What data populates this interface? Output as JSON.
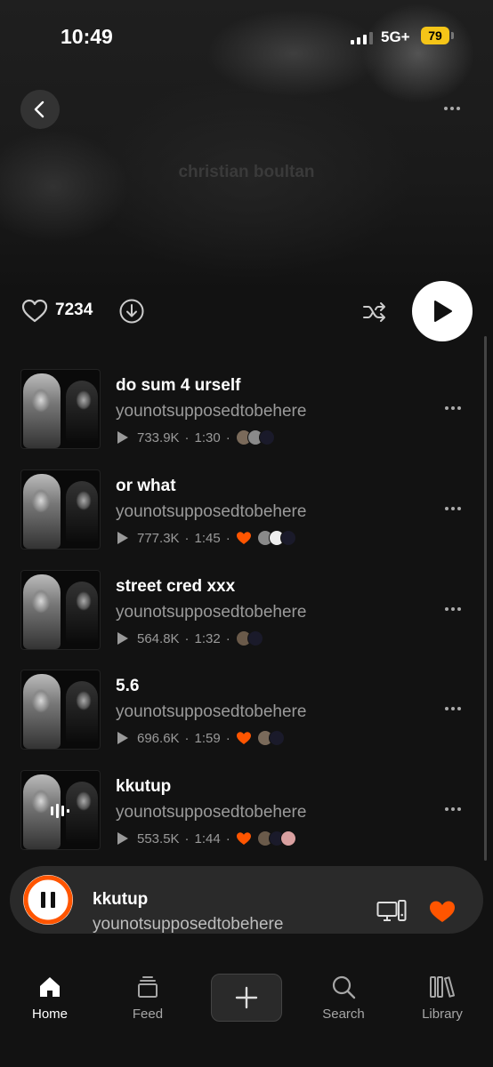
{
  "status_bar": {
    "time": "10:49",
    "network": "5G+",
    "battery": "79"
  },
  "header": {
    "playlist_title": "christian boultan"
  },
  "actions": {
    "like_count": "7234"
  },
  "tracks": [
    {
      "title": "do sum 4 urself",
      "artist": "younotsupposedtobehere",
      "plays": "733.9K",
      "duration": "1:30",
      "liked": false,
      "now_playing": false
    },
    {
      "title": "or what",
      "artist": "younotsupposedtobehere",
      "plays": "777.3K",
      "duration": "1:45",
      "liked": true,
      "now_playing": false
    },
    {
      "title": "street cred xxx",
      "artist": "younotsupposedtobehere",
      "plays": "564.8K",
      "duration": "1:32",
      "liked": false,
      "now_playing": false
    },
    {
      "title": "5.6",
      "artist": "younotsupposedtobehere",
      "plays": "696.6K",
      "duration": "1:59",
      "liked": true,
      "now_playing": false
    },
    {
      "title": "kkutup",
      "artist": "younotsupposedtobehere",
      "plays": "553.5K",
      "duration": "1:44",
      "liked": true,
      "now_playing": true
    }
  ],
  "now_playing": {
    "title": "kkutup",
    "artist": "younotsupposedtobehere",
    "state": "playing"
  },
  "tabs": [
    {
      "label": "Home",
      "icon": "home-icon",
      "active": true
    },
    {
      "label": "Feed",
      "icon": "feed-icon",
      "active": false
    },
    {
      "label": "Search",
      "icon": "search-icon",
      "active": false
    },
    {
      "label": "Library",
      "icon": "library-icon",
      "active": false
    }
  ],
  "colors": {
    "accent": "#ff5500",
    "background": "#121212",
    "battery": "#f5c518"
  }
}
